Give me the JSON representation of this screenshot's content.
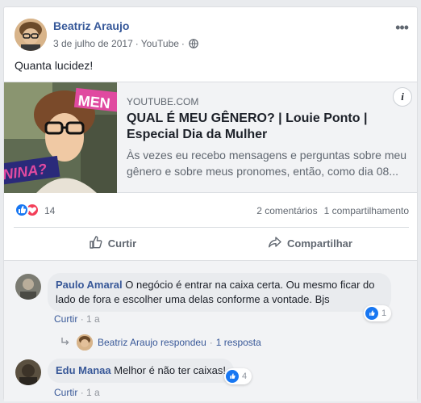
{
  "post": {
    "author": "Beatriz Araujo",
    "date": "3 de julho de 2017",
    "via": "YouTube",
    "separator": "·",
    "more_icon": "more-horizontal-icon",
    "message": "Quanta lucidez!"
  },
  "link": {
    "domain": "YOUTUBE.COM",
    "title": "QUAL É MEU GÊNERO? | Louie Ponto | Especial Dia da Mulher",
    "description": "Às vezes eu recebo mensagens e perguntas sobre meu gênero e sobre meus pronomes, então, como dia 08...",
    "thumb_text_top": "MEN",
    "thumb_text_bottom": "NINA?",
    "info_label": "i"
  },
  "reactions": {
    "count": "14",
    "comments": "2 comentários",
    "shares": "1 compartilhamento"
  },
  "actions": {
    "like": "Curtir",
    "share": "Compartilhar"
  },
  "comments": [
    {
      "name": "Paulo Amaral",
      "text": "O negócio é entrar na caixa certa. Ou mesmo ficar do lado de fora e escolher uma delas conforme a vontade. Bjs",
      "likes": "1",
      "like_label": "Curtir",
      "time": "1 a"
    },
    {
      "name": "Edu Manaa",
      "text": "Melhor é não ter caixas!",
      "likes": "4",
      "like_label": "Curtir",
      "time": "1 a"
    }
  ],
  "reply": {
    "text": "Beatriz Araujo respondeu",
    "count": "1 resposta"
  },
  "colors": {
    "link_blue": "#365899",
    "like_blue": "#1877f2",
    "love_red": "#f33e58",
    "text_gray": "#606770"
  }
}
